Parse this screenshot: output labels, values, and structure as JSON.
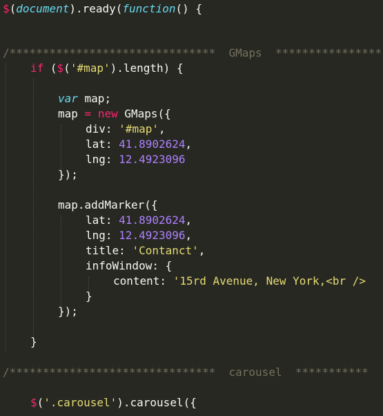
{
  "colors": {
    "background": "#272822",
    "default": "#f8f8f2",
    "keyword": "#f92672",
    "builtin": "#66d9ef",
    "string": "#e6db74",
    "number": "#ae81ff",
    "comment": "#75715e"
  },
  "code": {
    "l1": {
      "dollar": "$",
      "paren_open": "(",
      "document": "document",
      "ready": ").ready(",
      "function": "function",
      "rest": "() {"
    },
    "l4": {
      "stars_left": "/*******************************",
      "label": "GMaps",
      "stars_right": "****************"
    },
    "l5": {
      "if": "if",
      "open": " (",
      "dollar": "$",
      "paren": "(",
      "selector": "'#map'",
      "length": ").length) {"
    },
    "l7": {
      "var": "var",
      "map": " map;"
    },
    "l8": {
      "map": "map ",
      "eq": "=",
      "new": "new",
      "gmaps": " GMaps({"
    },
    "l9": {
      "key": "div: ",
      "val": "'#map'",
      "comma": ","
    },
    "l10": {
      "key": "lat: ",
      "val": "41.8902624",
      "comma": ","
    },
    "l11": {
      "key": "lng: ",
      "val": "12.4923096"
    },
    "l12": {
      "text": "});"
    },
    "l14": {
      "text": "map.addMarker({"
    },
    "l15": {
      "key": "lat: ",
      "val": "41.8902624",
      "comma": ","
    },
    "l16": {
      "key": "lng: ",
      "val": "12.4923096",
      "comma": ","
    },
    "l17": {
      "key": "title: ",
      "val": "'Contanct'",
      "comma": ","
    },
    "l18": {
      "key": "infoWindow: {"
    },
    "l19": {
      "key": "content: ",
      "val": "'15rd Avenue, New York,<br />"
    },
    "l20": {
      "text": "}"
    },
    "l21": {
      "text": "});"
    },
    "l23": {
      "text": "}"
    },
    "l25": {
      "stars_left": "/*******************************",
      "label": "carousel",
      "stars_right": "***********"
    },
    "l27": {
      "dollar": "$",
      "paren": "(",
      "selector": "'.carousel'",
      "rest": ").carousel({"
    }
  }
}
